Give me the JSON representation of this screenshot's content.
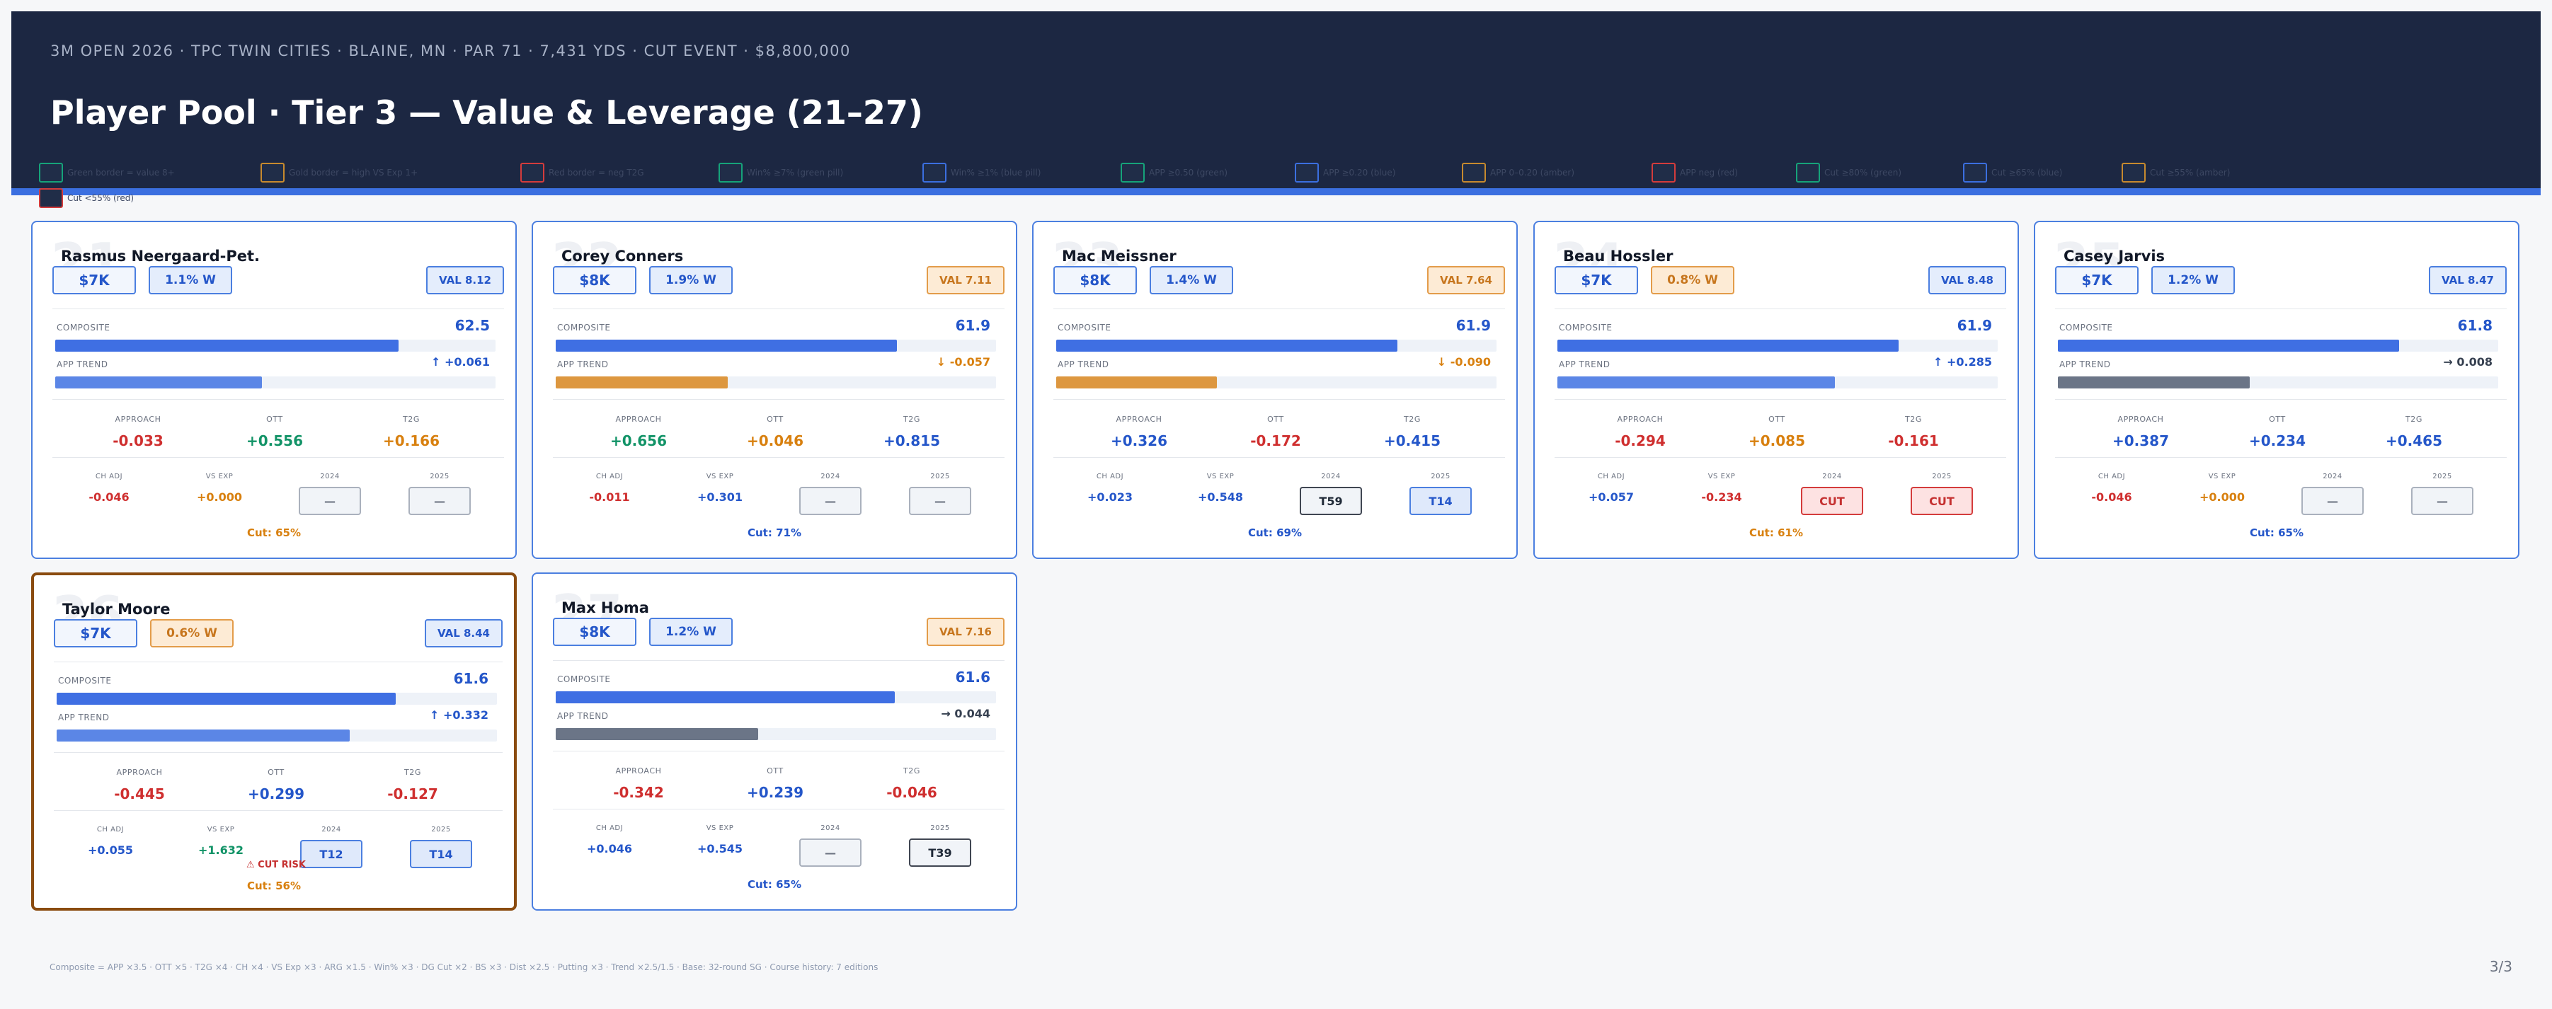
{
  "header": {
    "event_line": "3M OPEN 2026  ·  TPC TWIN CITIES  ·  BLAINE, MN  ·  PAR 71  ·  7,431 YDS  ·  CUT EVENT  ·  $8,800,000",
    "title": "Player Pool  ·  Tier 3 — Value & Leverage (21–27)"
  },
  "colors": {
    "header_bg": "#1c2742",
    "accent_blue": "#3b6fe0",
    "value_red": "#cf2f2f",
    "value_green": "#129367",
    "value_amber": "#d8800f",
    "value_blue": "#2456c9",
    "highlight_border": "#8a4b0f"
  },
  "legend": [
    {
      "label": "Green border = value 8+",
      "color": "#16a37a"
    },
    {
      "label": "Gold border = high VS Exp 1+",
      "color": "#c78a2e"
    },
    {
      "label": "Red border = neg T2G",
      "color": "#d43c3c"
    },
    {
      "label": "Win% ≥7% (green pill)",
      "color": "#16a37a"
    },
    {
      "label": "Win% ≥1% (blue pill)",
      "color": "#3b6fe0"
    },
    {
      "label": "APP ≥0.50 (green)",
      "color": "#16a37a"
    },
    {
      "label": "APP ≥0.20 (blue)",
      "color": "#3b6fe0"
    },
    {
      "label": "APP 0–0.20 (amber)",
      "color": "#c78a2e"
    },
    {
      "label": "APP neg (red)",
      "color": "#d43c3c"
    },
    {
      "label": "Cut ≥80% (green)",
      "color": "#16a37a"
    },
    {
      "label": "Cut ≥65% (blue)",
      "color": "#3b6fe0"
    },
    {
      "label": "Cut ≥55% (amber)",
      "color": "#c78a2e"
    },
    {
      "label": "Cut <55% (red)",
      "color": "#d43c3c"
    }
  ],
  "labels": {
    "composite": "COMPOSITE",
    "app_trend": "APP TREND",
    "approach": "APPROACH",
    "ott": "OTT",
    "t2g": "T2G",
    "ch_adj": "CH ADJ",
    "vs_exp": "VS EXP",
    "y2024": "2024",
    "y2025": "2025"
  },
  "players": [
    {
      "rank": "21",
      "name": "Rasmus Neergaard-Pet.",
      "salary": "$7K",
      "win": "1.1% W",
      "win_style": "blue",
      "val": "VAL 8.12",
      "val_style": "blue",
      "composite": "62.5",
      "composite_pct": 0.78,
      "trend": "↑ +0.061",
      "trend_color": "blue",
      "trend_pct": 0.47,
      "trend_bar": "#5b86e6",
      "approach": "-0.033",
      "approach_color": "red",
      "ott": "+0.556",
      "ott_color": "green",
      "t2g": "+0.166",
      "t2g_color": "amber",
      "ch_adj": "-0.046",
      "ch_adj_color": "red",
      "vs_exp": "+0.000",
      "vs_exp_color": "amber",
      "f2024": "—",
      "f2024_style": "none",
      "f2025": "—",
      "f2025_style": "none",
      "cut": "Cut: 65%",
      "cut_color": "amber",
      "cut_rise": ""
    },
    {
      "rank": "22",
      "name": "Corey Conners",
      "salary": "$8K",
      "win": "1.9% W",
      "win_style": "blue",
      "val": "VAL 7.11",
      "val_style": "gold",
      "composite": "61.9",
      "composite_pct": 0.775,
      "trend": "↓ -0.057",
      "trend_color": "amber",
      "trend_pct": 0.39,
      "trend_bar": "#dd973f",
      "approach": "+0.656",
      "approach_color": "green",
      "ott": "+0.046",
      "ott_color": "amber",
      "t2g": "+0.815",
      "t2g_color": "blue",
      "ch_adj": "-0.011",
      "ch_adj_color": "red",
      "vs_exp": "+0.301",
      "vs_exp_color": "blue",
      "f2024": "—",
      "f2024_style": "none",
      "f2025": "—",
      "f2025_style": "none",
      "cut": "Cut: 71%",
      "cut_color": "blue",
      "cut_rise": ""
    },
    {
      "rank": "23",
      "name": "Mac Meissner",
      "salary": "$8K",
      "win": "1.4% W",
      "win_style": "blue",
      "val": "VAL 7.64",
      "val_style": "gold",
      "composite": "61.9",
      "composite_pct": 0.775,
      "trend": "↓ -0.090",
      "trend_color": "amber",
      "trend_pct": 0.365,
      "trend_bar": "#dd973f",
      "approach": "+0.326",
      "approach_color": "blue",
      "ott": "-0.172",
      "ott_color": "red",
      "t2g": "+0.415",
      "t2g_color": "blue",
      "ch_adj": "+0.023",
      "ch_adj_color": "blue",
      "vs_exp": "+0.548",
      "vs_exp_color": "blue",
      "f2024": "T59",
      "f2024_style": "mid",
      "f2025": "T14",
      "f2025_style": "good",
      "cut": "Cut: 69%",
      "cut_color": "blue",
      "cut_rise": ""
    },
    {
      "rank": "24",
      "name": "Beau Hossler",
      "salary": "$7K",
      "win": "0.8% W",
      "win_style": "gold",
      "val": "VAL 8.48",
      "val_style": "blue",
      "composite": "61.9",
      "composite_pct": 0.775,
      "trend": "↑ +0.285",
      "trend_color": "blue",
      "trend_pct": 0.63,
      "trend_bar": "#5b86e6",
      "approach": "-0.294",
      "approach_color": "red",
      "ott": "+0.085",
      "ott_color": "amber",
      "t2g": "-0.161",
      "t2g_color": "red",
      "ch_adj": "+0.057",
      "ch_adj_color": "blue",
      "vs_exp": "-0.234",
      "vs_exp_color": "red",
      "f2024": "CUT",
      "f2024_style": "bad",
      "f2025": "CUT",
      "f2025_style": "bad",
      "cut": "Cut: 61%",
      "cut_color": "amber",
      "cut_rise": ""
    },
    {
      "rank": "25",
      "name": "Casey Jarvis",
      "salary": "$7K",
      "win": "1.2% W",
      "win_style": "blue",
      "val": "VAL 8.47",
      "val_style": "blue",
      "composite": "61.8",
      "composite_pct": 0.775,
      "trend": "→ 0.008",
      "trend_color": "gray",
      "trend_pct": 0.435,
      "trend_bar": "#6b7587",
      "approach": "+0.387",
      "approach_color": "blue",
      "ott": "+0.234",
      "ott_color": "blue",
      "t2g": "+0.465",
      "t2g_color": "blue",
      "ch_adj": "-0.046",
      "ch_adj_color": "red",
      "vs_exp": "+0.000",
      "vs_exp_color": "amber",
      "f2024": "—",
      "f2024_style": "none",
      "f2025": "—",
      "f2025_style": "none",
      "cut": "Cut: 65%",
      "cut_color": "blue",
      "cut_rise": ""
    },
    {
      "rank": "26",
      "name": "Taylor Moore",
      "salary": "$7K",
      "win": "0.6% W",
      "win_style": "gold",
      "val": "VAL 8.44",
      "val_style": "blue",
      "composite": "61.6",
      "composite_pct": 0.77,
      "trend": "↑ +0.332",
      "trend_color": "blue",
      "trend_pct": 0.665,
      "trend_bar": "#5b86e6",
      "approach": "-0.445",
      "approach_color": "red",
      "ott": "+0.299",
      "ott_color": "blue",
      "t2g": "-0.127",
      "t2g_color": "red",
      "ch_adj": "+0.055",
      "ch_adj_color": "blue",
      "vs_exp": "+1.632",
      "vs_exp_color": "green",
      "f2024": "T12",
      "f2024_style": "good",
      "f2025": "T14",
      "f2025_style": "good",
      "cut": "Cut: 56%",
      "cut_color": "amber",
      "cut_rise": "⚠ CUT RISK"
    },
    {
      "rank": "27",
      "name": "Max Homa",
      "salary": "$8K",
      "win": "1.2% W",
      "win_style": "blue",
      "val": "VAL 7.16",
      "val_style": "gold",
      "composite": "61.6",
      "composite_pct": 0.77,
      "trend": "→ 0.044",
      "trend_color": "gray",
      "trend_pct": 0.46,
      "trend_bar": "#6b7587",
      "approach": "-0.342",
      "approach_color": "red",
      "ott": "+0.239",
      "ott_color": "blue",
      "t2g": "-0.046",
      "t2g_color": "red",
      "ch_adj": "+0.046",
      "ch_adj_color": "blue",
      "vs_exp": "+0.545",
      "vs_exp_color": "blue",
      "f2024": "—",
      "f2024_style": "none",
      "f2025": "T39",
      "f2025_style": "mid",
      "cut": "Cut: 65%",
      "cut_color": "blue",
      "cut_rise": ""
    }
  ],
  "footer": {
    "note": "Composite = APP ×3.5 · OTT ×5 · T2G ×4 · CH ×4 · VS Exp ×3 · ARG ×1.5 · Win% ×3 · DG Cut ×2 · BS ×3 · Dist ×2.5 · Putting ×3 · Trend ×2.5/1.5  ·  Base: 32-round SG  ·  Course history: 7 editions",
    "page": "3/3"
  }
}
